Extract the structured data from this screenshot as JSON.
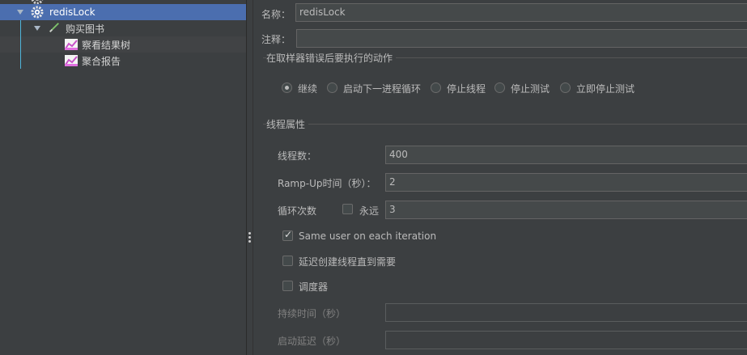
{
  "tree": {
    "items": [
      {
        "label": "redisLock"
      },
      {
        "label": "购买图书"
      },
      {
        "label": "察看结果树"
      },
      {
        "label": "聚合报告"
      }
    ]
  },
  "form": {
    "name_label": "名称：",
    "name_value": "redisLock",
    "comment_label": "注释：",
    "comment_value": "",
    "error_section": "在取样器错误后要执行的动作",
    "actions": [
      {
        "label": "继续",
        "selected": true
      },
      {
        "label": "启动下一进程循环",
        "selected": false
      },
      {
        "label": "停止线程",
        "selected": false
      },
      {
        "label": "停止测试",
        "selected": false
      },
      {
        "label": "立即停止测试",
        "selected": false
      }
    ],
    "thread_section": "线程属性",
    "threads_label": "线程数：",
    "threads_value": "400",
    "rampup_label": "Ramp-Up时间（秒）：",
    "rampup_value": "2",
    "loop_label": "循环次数",
    "forever_label": "永远",
    "loop_value": "3",
    "same_user_label": "Same user on each iteration",
    "delay_label": "延迟创建线程直到需要",
    "scheduler_label": "调度器",
    "duration_label": "持续时间（秒）",
    "startup_delay_label": "启动延迟（秒）"
  },
  "colors": {
    "background": "#3c3f41",
    "selection": "#4b6eaf",
    "guide_line": "#4fb4d8",
    "field_bg": "#45494a"
  }
}
